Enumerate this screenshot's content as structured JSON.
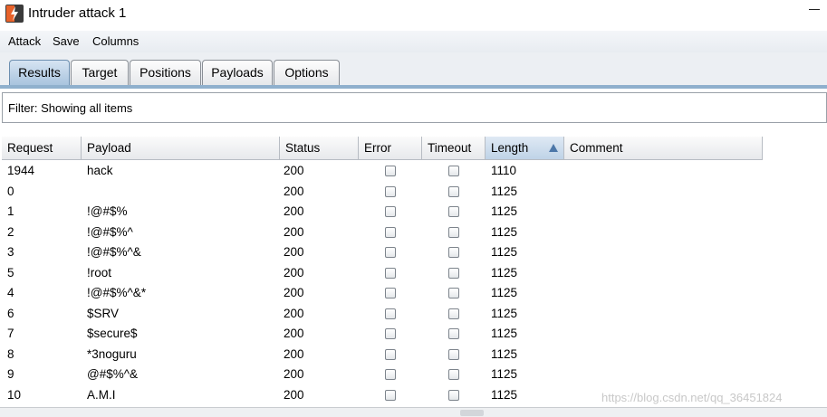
{
  "window": {
    "title": "Intruder attack 1"
  },
  "menu": [
    "Attack",
    "Save",
    "Columns"
  ],
  "tabs": [
    {
      "label": "Results",
      "active": true
    },
    {
      "label": "Target",
      "active": false
    },
    {
      "label": "Positions",
      "active": false
    },
    {
      "label": "Payloads",
      "active": false
    },
    {
      "label": "Options",
      "active": false
    }
  ],
  "filter": {
    "text": "Filter:  Showing all items"
  },
  "table": {
    "columns": [
      "Request",
      "Payload",
      "Status",
      "Error",
      "Timeout",
      "Length",
      "Comment"
    ],
    "sorted_column": "Length",
    "rows": [
      {
        "request": "1944",
        "payload": "hack",
        "status": "200",
        "length": "1110"
      },
      {
        "request": "0",
        "payload": "",
        "status": "200",
        "length": "1125"
      },
      {
        "request": "1",
        "payload": "!@#$%",
        "status": "200",
        "length": "1125"
      },
      {
        "request": "2",
        "payload": "!@#$%^",
        "status": "200",
        "length": "1125"
      },
      {
        "request": "3",
        "payload": "!@#$%^&",
        "status": "200",
        "length": "1125"
      },
      {
        "request": "5",
        "payload": "!root",
        "status": "200",
        "length": "1125"
      },
      {
        "request": "4",
        "payload": "!@#$%^&*",
        "status": "200",
        "length": "1125"
      },
      {
        "request": "6",
        "payload": "$SRV",
        "status": "200",
        "length": "1125"
      },
      {
        "request": "7",
        "payload": "$secure$",
        "status": "200",
        "length": "1125"
      },
      {
        "request": "8",
        "payload": "*3noguru",
        "status": "200",
        "length": "1125"
      },
      {
        "request": "9",
        "payload": "@#$%^&",
        "status": "200",
        "length": "1125"
      },
      {
        "request": "10",
        "payload": "A.M.I",
        "status": "200",
        "length": "1125"
      }
    ]
  },
  "watermark": "https://blog.csdn.net/qq_36451824",
  "colors": {
    "accent": "#8fb0cd",
    "sort_arrow": "#4c77a8"
  },
  "icons": {
    "app": "burp-lightning-icon"
  }
}
